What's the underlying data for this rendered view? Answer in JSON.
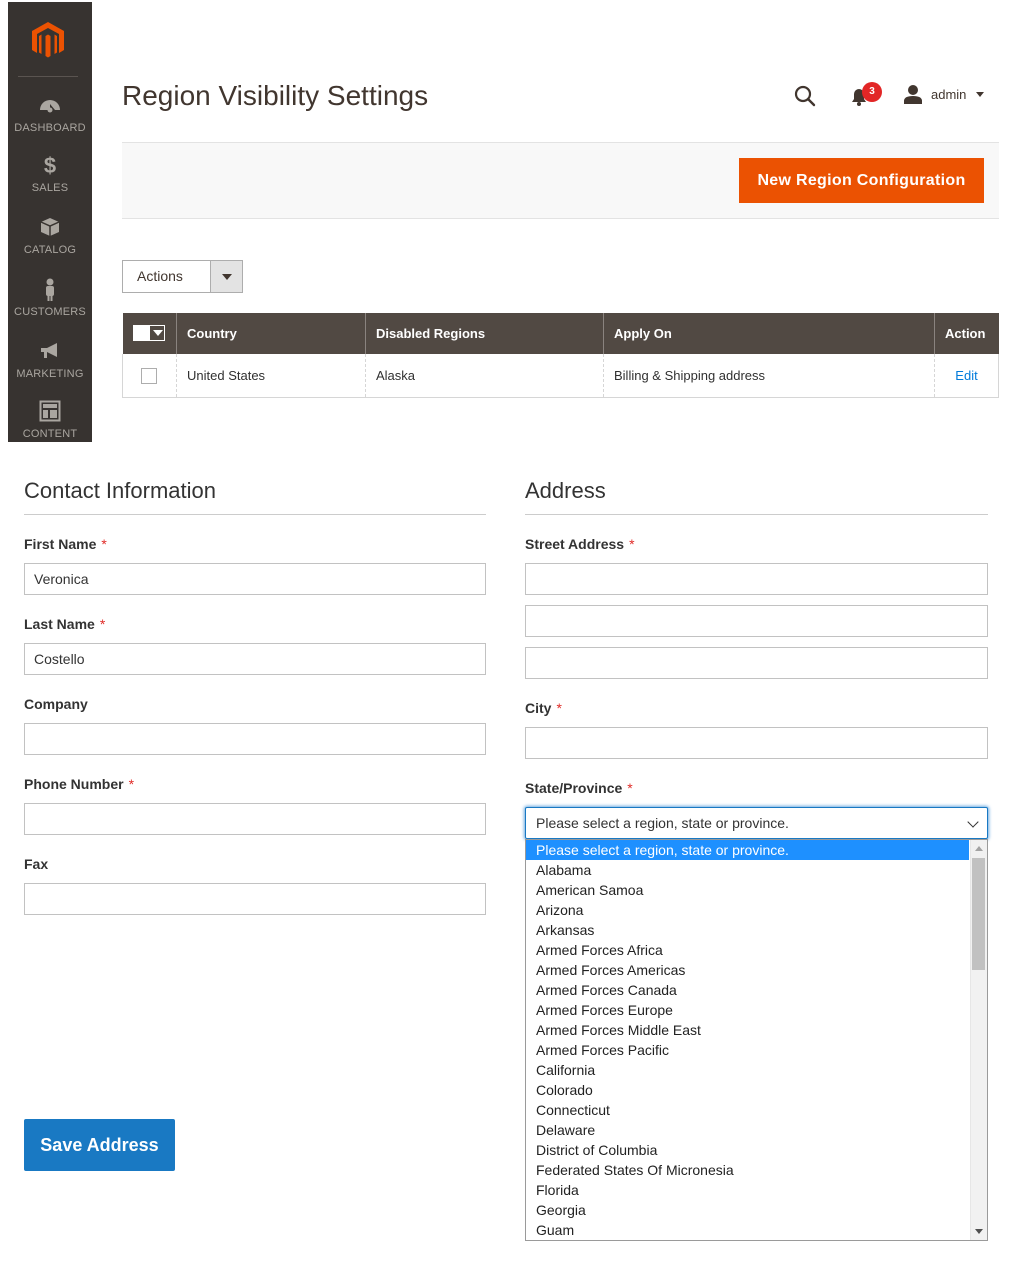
{
  "sidebar": {
    "logo": "magento-logo",
    "items": [
      {
        "label": "DASHBOARD",
        "icon": "dashboard-icon"
      },
      {
        "label": "SALES",
        "icon": "dollar-icon"
      },
      {
        "label": "CATALOG",
        "icon": "box-icon"
      },
      {
        "label": "CUSTOMERS",
        "icon": "person-icon"
      },
      {
        "label": "MARKETING",
        "icon": "megaphone-icon"
      },
      {
        "label": "CONTENT",
        "icon": "layout-icon"
      }
    ]
  },
  "header": {
    "title": "Region Visibility Settings",
    "notifications_count": "3",
    "user": "admin"
  },
  "toolbar": {
    "new_button_label": "New Region Configuration",
    "actions_label": "Actions"
  },
  "grid": {
    "columns": [
      "Country",
      "Disabled Regions",
      "Apply On",
      "Action"
    ],
    "rows": [
      {
        "country": "United States",
        "disabled_regions": "Alaska",
        "apply_on": "Billing & Shipping address",
        "action": "Edit"
      }
    ]
  },
  "form": {
    "contact_title": "Contact Information",
    "address_title": "Address",
    "first_name_label": "First Name",
    "first_name_value": "Veronica",
    "last_name_label": "Last Name",
    "last_name_value": "Costello",
    "company_label": "Company",
    "company_value": "",
    "phone_label": "Phone Number",
    "phone_value": "",
    "fax_label": "Fax",
    "fax_value": "",
    "street_label": "Street Address",
    "street_values": [
      "",
      "",
      ""
    ],
    "city_label": "City",
    "city_value": "",
    "state_label": "State/Province",
    "state_value": "Please select a region, state or province.",
    "required_mark": "*",
    "save_label": "Save Address"
  },
  "state_options": [
    "Please select a region, state or province.",
    "Alabama",
    "American Samoa",
    "Arizona",
    "Arkansas",
    "Armed Forces Africa",
    "Armed Forces Americas",
    "Armed Forces Canada",
    "Armed Forces Europe",
    "Armed Forces Middle East",
    "Armed Forces Pacific",
    "California",
    "Colorado",
    "Connecticut",
    "Delaware",
    "District of Columbia",
    "Federated States Of Micronesia",
    "Florida",
    "Georgia",
    "Guam"
  ],
  "selected_option_index": 0,
  "colors": {
    "sidebar_bg": "#373330",
    "accent_orange": "#eb5202",
    "grid_header": "#514943",
    "link_blue": "#007bdb",
    "save_blue": "#1979c3",
    "highlight_blue": "#1e90ff",
    "required_red": "#e02b27"
  }
}
